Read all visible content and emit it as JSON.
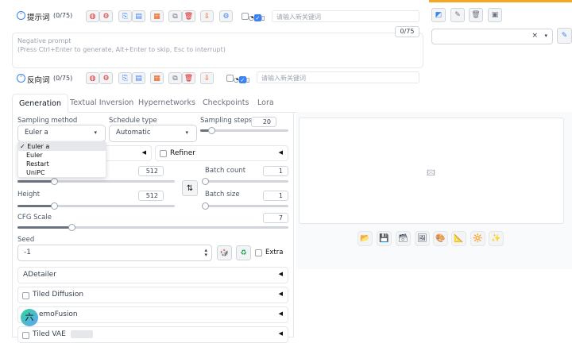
{
  "prompt": {
    "label": "提示词",
    "count": "(0/75)",
    "keyword_placeholder": "请输入新关键词"
  },
  "negative": {
    "counter": "0/75",
    "placeholder": "Negative prompt\n(Press Ctrl+Enter to generate, Alt+Enter to skip, Esc to interrupt)",
    "label": "反向词",
    "count": "(0/75)",
    "keyword_placeholder": "请输入新关键词"
  },
  "tabs": [
    "Generation",
    "Textual Inversion",
    "Hypernetworks",
    "Checkpoints",
    "Lora"
  ],
  "sampling": {
    "method_label": "Sampling method",
    "method_value": "Euler a",
    "schedule_label": "Schedule type",
    "schedule_value": "Automatic",
    "steps_label": "Sampling steps",
    "steps_value": "20",
    "steps_level": 0.13,
    "options": [
      "Euler a",
      "Euler",
      "Restart",
      "UniPC"
    ],
    "selected_mark": "✓"
  },
  "refiner_label": "Refiner",
  "width": {
    "value": "512",
    "level": 0.23
  },
  "height": {
    "label": "Height",
    "value": "512",
    "level": 0.23
  },
  "batch_count": {
    "label": "Batch count",
    "value": "1",
    "level": 0.0
  },
  "batch_size": {
    "label": "Batch size",
    "value": "1",
    "level": 0.0
  },
  "cfg": {
    "label": "CFG Scale",
    "value": "7",
    "level": 0.2
  },
  "seed": {
    "label": "Seed",
    "value": "-1",
    "extra_label": "Extra"
  },
  "accordions": {
    "adetailer": "ADetailer",
    "tiled_diffusion": "Tiled Diffusion",
    "demofusion": "emoFusion",
    "tiled_vae": "Tiled VAE"
  },
  "avatar_char": "六",
  "icons": {
    "prompt_collapse": "chevron-up-circle-icon",
    "globe": "globe-icon",
    "settings": "gear-icon",
    "image": "image-placeholder-icon",
    "swap": "swap-icon",
    "dice": "dice-icon",
    "recycle": "recycle-icon",
    "folder": "folder-icon",
    "save": "save-icon",
    "zip": "zip-icon",
    "picture": "picture-icon",
    "palette": "palette-icon",
    "ruler": "ruler-icon",
    "extras": "extras-icon",
    "sparkle": "sparkle-icon",
    "pencil": "pencil-icon"
  },
  "colors": {
    "accent": "#f5a623",
    "primary": "#3b82f6"
  }
}
